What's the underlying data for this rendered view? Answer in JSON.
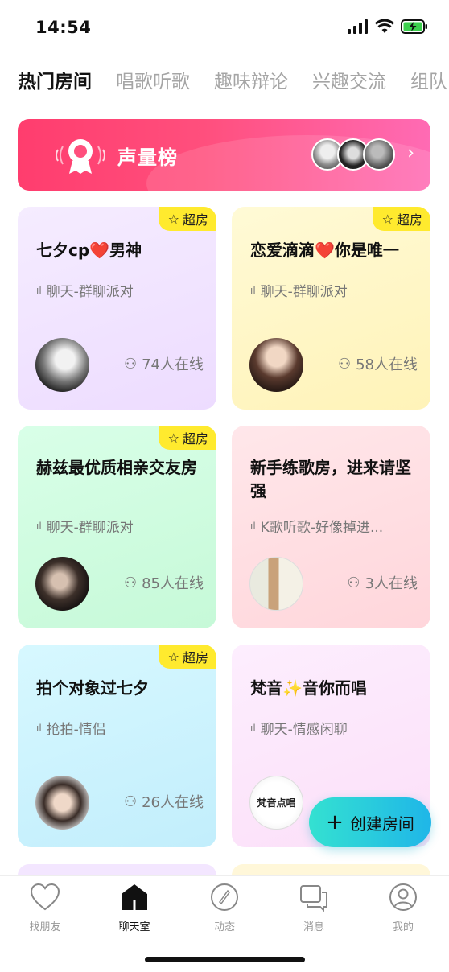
{
  "status": {
    "time": "14:54"
  },
  "tabs": [
    {
      "label": "热门房间",
      "active": true
    },
    {
      "label": "唱歌听歌",
      "active": false
    },
    {
      "label": "趣味辩论",
      "active": false
    },
    {
      "label": "兴趣交流",
      "active": false
    },
    {
      "label": "组队",
      "active": false
    }
  ],
  "banner": {
    "title": "声量榜"
  },
  "rooms": [
    {
      "badge": "超房",
      "title": "七夕cp❤️男神",
      "sub": "聊天-群聊派对",
      "online": "74人在线"
    },
    {
      "badge": "超房",
      "title": "恋爱滴滴❤️你是唯一",
      "sub": "聊天-群聊派对",
      "online": "58人在线"
    },
    {
      "badge": "超房",
      "title": "赫兹最优质相亲交友房",
      "sub": "聊天-群聊派对",
      "online": "85人在线"
    },
    {
      "badge": "",
      "title": "新手练歌房，进来请坚强",
      "sub": "K歌听歌-好像掉进...",
      "online": "3人在线"
    },
    {
      "badge": "超房",
      "title": "拍个对象过七夕",
      "sub": "抢拍-情侣",
      "online": "26人在线"
    },
    {
      "badge": "",
      "title": "梵音✨音你而唱",
      "sub": "聊天-情感闲聊",
      "online": "",
      "avatar_text": "梵音点唱"
    }
  ],
  "fab": {
    "label": "创建房间"
  },
  "tabbar": [
    {
      "label": "找朋友",
      "icon": "heart-icon"
    },
    {
      "label": "聊天室",
      "icon": "house-icon"
    },
    {
      "label": "动态",
      "icon": "compass-icon"
    },
    {
      "label": "消息",
      "icon": "chat-bubble-icon"
    },
    {
      "label": "我的",
      "icon": "profile-icon"
    }
  ]
}
